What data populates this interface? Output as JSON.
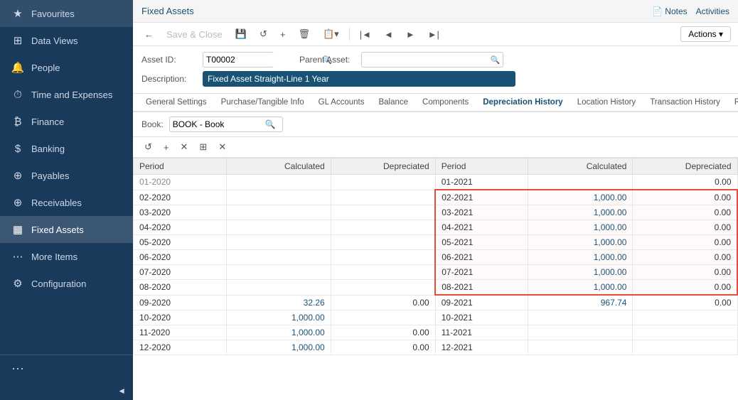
{
  "sidebar": {
    "items": [
      {
        "id": "favourites",
        "label": "Favourites",
        "icon": "★"
      },
      {
        "id": "data-views",
        "label": "Data Views",
        "icon": "⊞"
      },
      {
        "id": "people",
        "label": "People",
        "icon": "🔔"
      },
      {
        "id": "time-expenses",
        "label": "Time and Expenses",
        "icon": "⏱"
      },
      {
        "id": "finance",
        "label": "Finance",
        "icon": "₿"
      },
      {
        "id": "banking",
        "label": "Banking",
        "icon": "$"
      },
      {
        "id": "payables",
        "label": "Payables",
        "icon": "⊕"
      },
      {
        "id": "receivables",
        "label": "Receivables",
        "icon": "⊕"
      },
      {
        "id": "fixed-assets",
        "label": "Fixed Assets",
        "icon": "▦"
      },
      {
        "id": "more-items",
        "label": "More Items",
        "icon": "⋯"
      },
      {
        "id": "configuration",
        "label": "Configuration",
        "icon": "⚙"
      }
    ]
  },
  "topbar": {
    "title": "Fixed Assets",
    "actions": [
      "Notes",
      "Activities"
    ]
  },
  "toolbar": {
    "back_label": "←",
    "save_close_label": "Save & Close",
    "save_icon": "💾",
    "undo_label": "↺",
    "add_label": "+",
    "delete_label": "🗑",
    "copy_label": "📋",
    "first_label": "|◄",
    "prev_label": "◄",
    "next_label": "►",
    "last_label": "►|",
    "actions_label": "Actions ▾"
  },
  "form": {
    "asset_id_label": "Asset ID:",
    "asset_id_value": "T00002",
    "parent_asset_label": "Parent Asset:",
    "description_label": "Description:",
    "description_value": "Fixed Asset Straight-Line 1 Year"
  },
  "tabs": [
    {
      "id": "general",
      "label": "General Settings"
    },
    {
      "id": "purchase",
      "label": "Purchase/Tangible Info"
    },
    {
      "id": "accounts",
      "label": "GL Accounts"
    },
    {
      "id": "balance",
      "label": "Balance"
    },
    {
      "id": "components",
      "label": "Components"
    },
    {
      "id": "depreciation",
      "label": "Depreciation History",
      "active": true
    },
    {
      "id": "location",
      "label": "Location History"
    },
    {
      "id": "transaction",
      "label": "Transaction History"
    },
    {
      "id": "reconciliation",
      "label": "Reconciliation"
    }
  ],
  "book": {
    "label": "Book:",
    "value": "BOOK - Book"
  },
  "grid": {
    "headers_left": [
      "Period",
      "Calculated",
      "Depreciated"
    ],
    "headers_right": [
      "Period",
      "Calculated",
      "Depreciated"
    ],
    "rows_left": [
      {
        "period": "01-2020",
        "calculated": "",
        "depreciated": ""
      },
      {
        "period": "02-2020",
        "calculated": "",
        "depreciated": ""
      },
      {
        "period": "03-2020",
        "calculated": "",
        "depreciated": ""
      },
      {
        "period": "04-2020",
        "calculated": "",
        "depreciated": ""
      },
      {
        "period": "05-2020",
        "calculated": "",
        "depreciated": ""
      },
      {
        "period": "06-2020",
        "calculated": "",
        "depreciated": ""
      },
      {
        "period": "07-2020",
        "calculated": "",
        "depreciated": ""
      },
      {
        "period": "08-2020",
        "calculated": "",
        "depreciated": ""
      },
      {
        "period": "09-2020",
        "calculated": "32.26",
        "depreciated": "0.00"
      },
      {
        "period": "10-2020",
        "calculated": "1,000.00",
        "depreciated": ""
      },
      {
        "period": "11-2020",
        "calculated": "1,000.00",
        "depreciated": "0.00"
      },
      {
        "period": "12-2020",
        "calculated": "1,000.00",
        "depreciated": "0.00"
      }
    ],
    "rows_right": [
      {
        "period": "01-2021",
        "calculated": "",
        "depreciated": "0.00",
        "highlight": false
      },
      {
        "period": "02-2021",
        "calculated": "1,000.00",
        "depreciated": "0.00",
        "highlight": true
      },
      {
        "period": "03-2021",
        "calculated": "1,000.00",
        "depreciated": "0.00",
        "highlight": true
      },
      {
        "period": "04-2021",
        "calculated": "1,000.00",
        "depreciated": "0.00",
        "highlight": true
      },
      {
        "period": "05-2021",
        "calculated": "1,000.00",
        "depreciated": "0.00",
        "highlight": true
      },
      {
        "period": "06-2021",
        "calculated": "1,000.00",
        "depreciated": "0.00",
        "highlight": true
      },
      {
        "period": "07-2021",
        "calculated": "1,000.00",
        "depreciated": "0.00",
        "highlight": true
      },
      {
        "period": "08-2021",
        "calculated": "1,000.00",
        "depreciated": "0.00",
        "highlight": true
      },
      {
        "period": "09-2021",
        "calculated": "967.74",
        "depreciated": "0.00",
        "highlight": false
      },
      {
        "period": "10-2021",
        "calculated": "",
        "depreciated": "",
        "highlight": false
      },
      {
        "period": "11-2021",
        "calculated": "",
        "depreciated": "",
        "highlight": false
      },
      {
        "period": "12-2021",
        "calculated": "",
        "depreciated": "",
        "highlight": false
      }
    ]
  }
}
